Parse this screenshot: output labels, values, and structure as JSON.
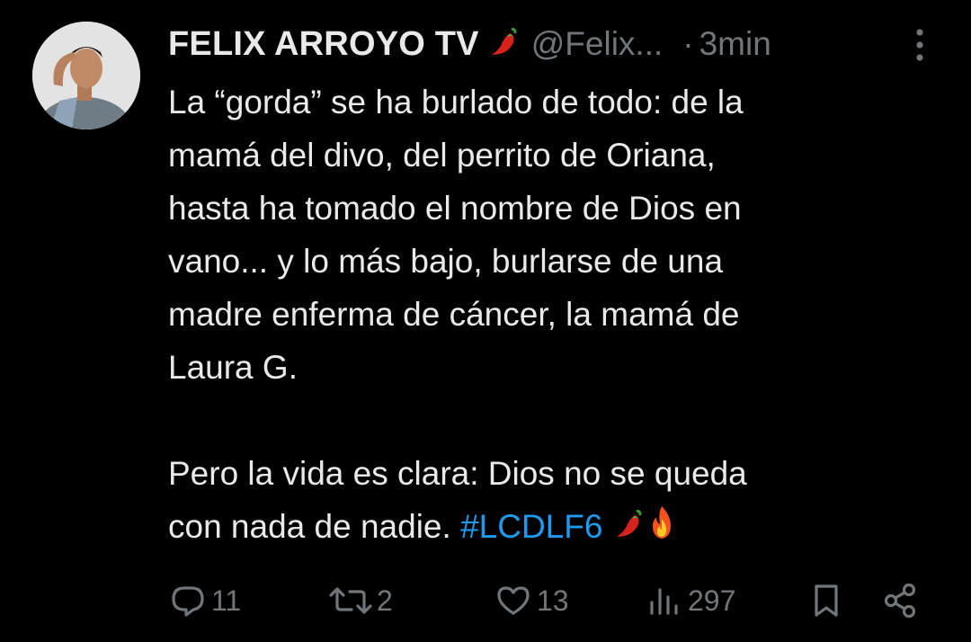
{
  "author": {
    "display_name": "FELIX ARROYO TV",
    "name_emoji": "chili-pepper",
    "handle": "@Felix...",
    "separator": "·",
    "time": "3min"
  },
  "tweet": {
    "lines_paragraph1": [
      "La “gorda” se ha burlado de todo: de la",
      "mamá del divo, del perrito de Oriana,",
      "hasta ha tomado el nombre de Dios en",
      "vano... y lo más bajo, burlarse de una",
      "madre enferma de cáncer, la mamá de",
      "Laura G."
    ],
    "line_paragraph2_a": "Pero la vida es clara: Dios no se queda",
    "line_paragraph2_b": "con nada de nadie. ",
    "hashtag": "#LCDLF6",
    "trailing_emojis": [
      "chili-pepper",
      "fire"
    ]
  },
  "actions": {
    "reply_count": "11",
    "retweet_count": "2",
    "like_count": "13",
    "view_count": "297"
  },
  "colors": {
    "background": "#000000",
    "text": "#e7e9ea",
    "secondary": "#71767b",
    "link": "#1d9bf0"
  }
}
